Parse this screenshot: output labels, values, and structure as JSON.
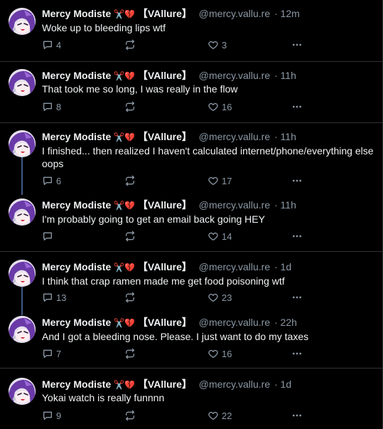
{
  "theme": {
    "background": "#000000",
    "divider": "#2f3336",
    "muted": "#8b98a5",
    "text": "#f1f3f5",
    "thread_line": "#3e5a86"
  },
  "posts": [
    {
      "display_name": "Mercy Modiste",
      "badge_emoji": "✂️💔",
      "tag": "【VAllure】",
      "handle": "@mercy.vallu.re",
      "time": "· 12m",
      "text": "Woke up to bleeding lips wtf",
      "replies": "4",
      "likes": "3"
    },
    {
      "display_name": "Mercy Modiste",
      "badge_emoji": "✂️💔",
      "tag": "【VAllure】",
      "handle": "@mercy.vallu.re",
      "time": "· 11h",
      "text": "That took me so long, I was really in the flow",
      "replies": "8",
      "likes": "16"
    },
    {
      "display_name": "Mercy Modiste",
      "badge_emoji": "✂️💔",
      "tag": "【VAllure】",
      "handle": "@mercy.vallu.re",
      "time": "· 11h",
      "text": "I finished... then realized I haven't calculated internet/phone/everything else oops",
      "replies": "6",
      "likes": "17"
    },
    {
      "display_name": "Mercy Modiste",
      "badge_emoji": "✂️💔",
      "tag": "【VAllure】",
      "handle": "@mercy.vallu.re",
      "time": "· 11h",
      "text": "I'm probably going to get an email back going HEY",
      "replies": "",
      "likes": "14"
    },
    {
      "display_name": "Mercy Modiste",
      "badge_emoji": "✂️💔",
      "tag": "【VAllure】",
      "handle": "@mercy.vallu.re",
      "time": "· 1d",
      "text": "I think that crap ramen made me get food poisoning wtf",
      "replies": "13",
      "likes": "23"
    },
    {
      "display_name": "Mercy Modiste",
      "badge_emoji": "✂️💔",
      "tag": "【VAllure】",
      "handle": "@mercy.vallu.re",
      "time": "· 22h",
      "text": "And I got a bleeding nose. Please. I just want to do my taxes",
      "replies": "7",
      "likes": "16"
    },
    {
      "display_name": "Mercy Modiste",
      "badge_emoji": "✂️💔",
      "tag": "【VAllure】",
      "handle": "@mercy.vallu.re",
      "time": "· 1d",
      "text": "Yokai watch is really funnnn",
      "replies": "9",
      "likes": "22"
    }
  ]
}
